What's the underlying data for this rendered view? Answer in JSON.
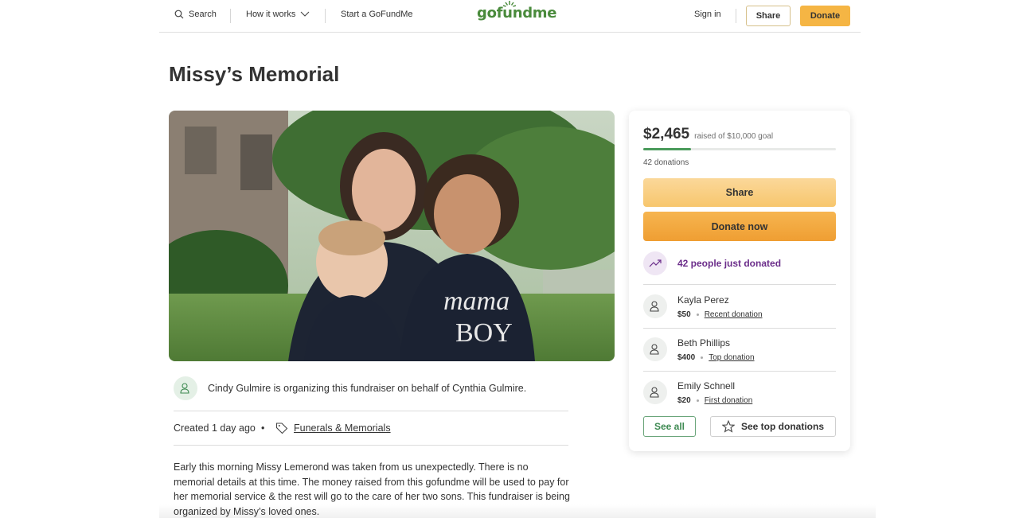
{
  "header": {
    "search_label": "Search",
    "how_label": "How it works",
    "start_label": "Start a GoFundMe",
    "logo_text": "gofundme",
    "signin_label": "Sign in",
    "share_label": "Share",
    "donate_label": "Donate"
  },
  "page": {
    "title": "Missy’s Memorial"
  },
  "organizer": {
    "text": "Cindy Gulmire is organizing this fundraiser on behalf of Cynthia Gulmire."
  },
  "meta": {
    "created": "Created 1 day ago",
    "dot": "•",
    "category": "Funerals & Memorials"
  },
  "story": {
    "text": "Early this morning Missy Lemerond was taken from us unexpectedly. There is no memorial details at this time. The money raised from this gofundme will be used to pay for her memorial service & the rest will go to the care of her two sons. This fundraiser is being organized by Missy’s loved ones."
  },
  "card": {
    "raised_amount": "$2,465",
    "raised_goal": "raised of $10,000 goal",
    "progress_fraction": 0.2465,
    "donation_count": "42 donations",
    "share_label": "Share",
    "donate_label": "Donate now",
    "trend_text": "42 people just donated",
    "donors": [
      {
        "name": "Kayla Perez",
        "amount": "$50",
        "label": "Recent donation"
      },
      {
        "name": "Beth Phillips",
        "amount": "$400",
        "label": "Top donation"
      },
      {
        "name": "Emily Schnell",
        "amount": "$20",
        "label": "First donation"
      }
    ],
    "see_all_label": "See all",
    "see_top_label": "See top donations"
  },
  "colors": {
    "brand_green": "#4a8b3c",
    "donate_orange": "#f5b544",
    "trend_purple": "#6b2d8a"
  },
  "icons": [
    "search-icon",
    "chevron-down-icon",
    "sun-logo-icon",
    "user-heart-icon",
    "tag-icon",
    "trend-up-icon",
    "star-icon"
  ]
}
